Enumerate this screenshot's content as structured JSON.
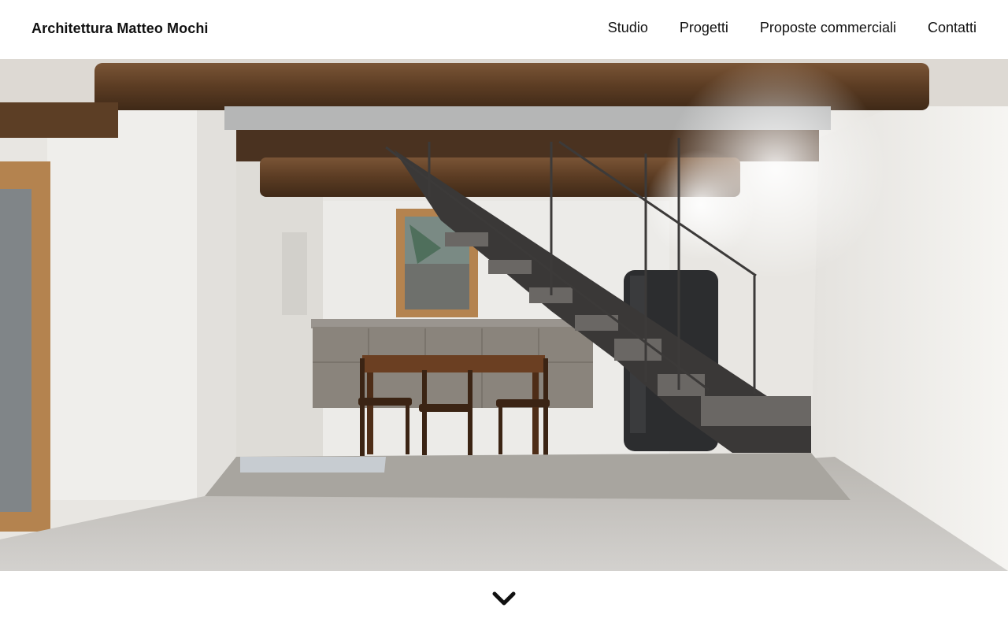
{
  "header": {
    "brand": "Architettura Matteo Mochi",
    "nav": [
      {
        "label": "Studio"
      },
      {
        "label": "Progetti"
      },
      {
        "label": "Proposte commerciali"
      },
      {
        "label": "Contatti"
      }
    ]
  },
  "hero": {
    "image_icon": "interior-photo",
    "scroll_icon": "chevron-down-icon"
  },
  "colors": {
    "text": "#111111",
    "background": "#ffffff"
  }
}
